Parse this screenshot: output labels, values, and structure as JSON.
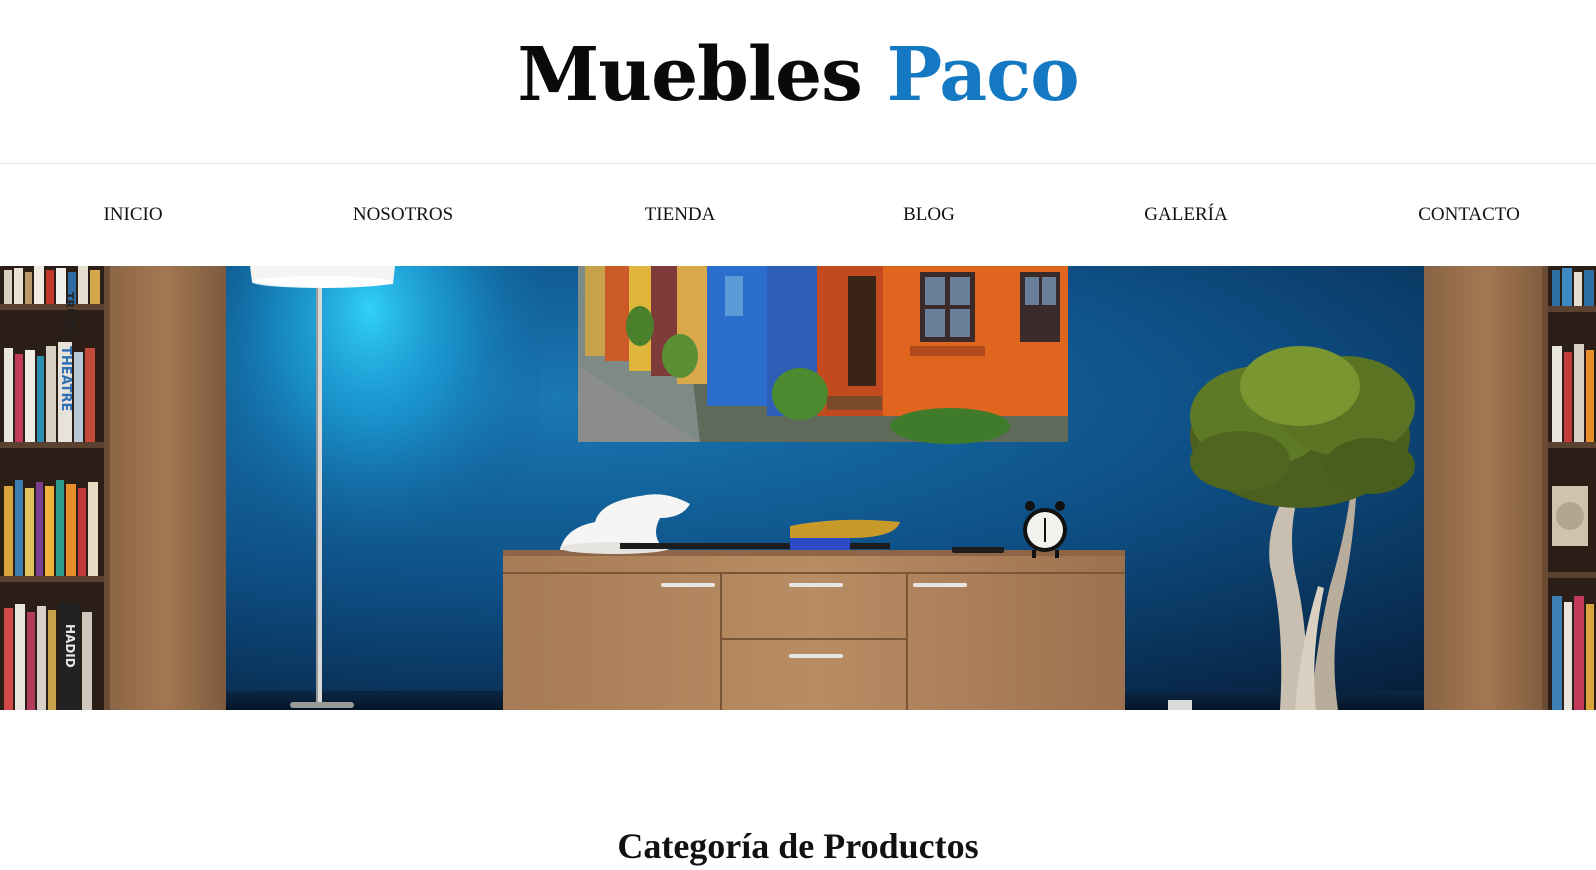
{
  "header": {
    "title_part1": "Muebles",
    "title_part2": "Paco"
  },
  "nav": {
    "items": [
      {
        "label": "INICIO"
      },
      {
        "label": "NOSOTROS"
      },
      {
        "label": "TIENDA"
      },
      {
        "label": "BLOG"
      },
      {
        "label": "GALERÍA"
      },
      {
        "label": "CONTACTO"
      }
    ]
  },
  "hero": {
    "book_spines": [
      "TRUTH",
      "THEATRE",
      "HADID"
    ]
  },
  "section": {
    "title": "Categoría de Productos"
  },
  "colors": {
    "brand_blue": "#1479c2",
    "wall_blue": "#0c4a78",
    "text_dark": "#111111"
  }
}
